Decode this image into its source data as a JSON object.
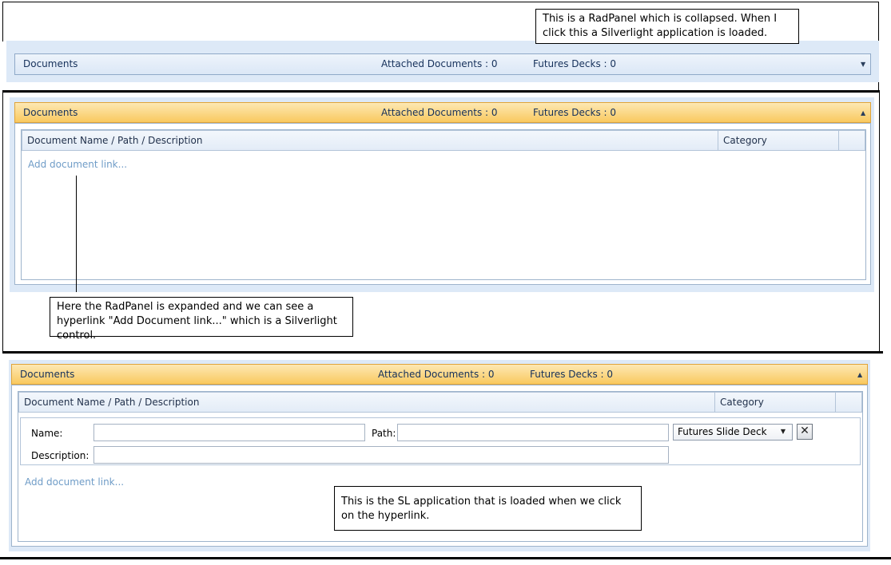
{
  "panel": {
    "title": "Documents",
    "attached_label": "Attached Documents : 0",
    "futures_label": "Futures Decks : 0"
  },
  "grid": {
    "col_name": "Document Name / Path / Description",
    "col_category": "Category"
  },
  "add_link": "Add document link...",
  "form": {
    "name_label": "Name:",
    "path_label": "Path:",
    "description_label": "Description:",
    "category_value": "Futures Slide Deck",
    "remove_glyph": "✕"
  },
  "callouts": {
    "collapsed": "This is a RadPanel which is collapsed. When I click this a Silverlight application is loaded.",
    "expanded": "Here the RadPanel is expanded and we can see a hyperlink \"Add Document link...\" which is a Silverlight control.",
    "sl_app": "This is the SL application that is loaded when we click on the hyperlink."
  },
  "colors": {
    "collapsed_header": "#dbe7f6",
    "expanded_header": "#f9c95f",
    "panel_background": "#dde9f7",
    "link": "#6f9cc7"
  }
}
